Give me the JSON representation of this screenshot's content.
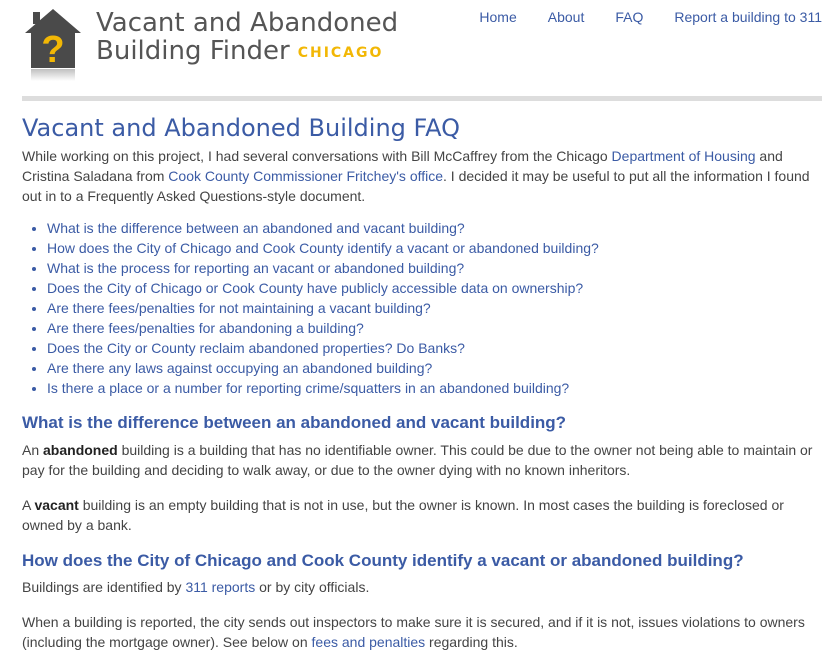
{
  "header": {
    "title_line1": "Vacant and Abandoned",
    "title_line2": "Building Finder",
    "title_city": "CHICAGO",
    "logo_glyph": "?",
    "nav": [
      "Home",
      "About",
      "FAQ",
      "Report a building to 311"
    ]
  },
  "page": {
    "heading": "Vacant and Abandoned Building FAQ",
    "intro": {
      "t1": "While working on this project, I had several conversations with Bill McCaffrey from the Chicago ",
      "link1": "Department of Housing",
      "t2": " and Cristina Saladana from ",
      "link2": "Cook County Commissioner Fritchey's office",
      "t3": ". I decided it may be useful to put all the information I found out in to a Frequently Asked Questions-style document."
    },
    "toc": [
      "What is the difference between an abandoned and vacant building?",
      "How does the City of Chicago and Cook County identify a vacant or abandoned building?",
      "What is the process for reporting an vacant or abandoned building?",
      "Does the City of Chicago or Cook County have publicly accessible data on ownership?",
      "Are there fees/penalties for not maintaining a vacant building?",
      "Are there fees/penalties for abandoning a building?",
      "Does the City or County reclaim abandoned properties? Do Banks?",
      "Are there any laws against occupying an abandoned building?",
      "Is there a place or a number for reporting crime/squatters in an abandoned building?"
    ],
    "q1": {
      "heading": "What is the difference between an abandoned and vacant building?",
      "p1_pre": "An ",
      "p1_bold": "abandoned",
      "p1_post": " building is a building that has no identifiable owner. This could be due to the owner not being able to maintain or pay for the building and deciding to walk away, or due to the owner dying with no known inheritors.",
      "p2_pre": "A ",
      "p2_bold": "vacant",
      "p2_post": " building is an empty building that is not in use, but the owner is known. In most cases the building is foreclosed or owned by a bank."
    },
    "q2": {
      "heading": "How does the City of Chicago and Cook County identify a vacant or abandoned building?",
      "p1_pre": "Buildings are identified by ",
      "p1_link": "311 reports",
      "p1_post": " or by city officials.",
      "p2_pre": "When a building is reported, the city sends out inspectors to make sure it is secured, and if it is not, issues violations to owners (including the mortgage owner). See below on ",
      "p2_link": "fees and penalties",
      "p2_post": " regarding this."
    }
  },
  "colors": {
    "link": "#3b5ba5",
    "text": "#444444",
    "accent": "#f2b705",
    "logo_house": "#4a4a4a",
    "rule": "#dddddd"
  }
}
